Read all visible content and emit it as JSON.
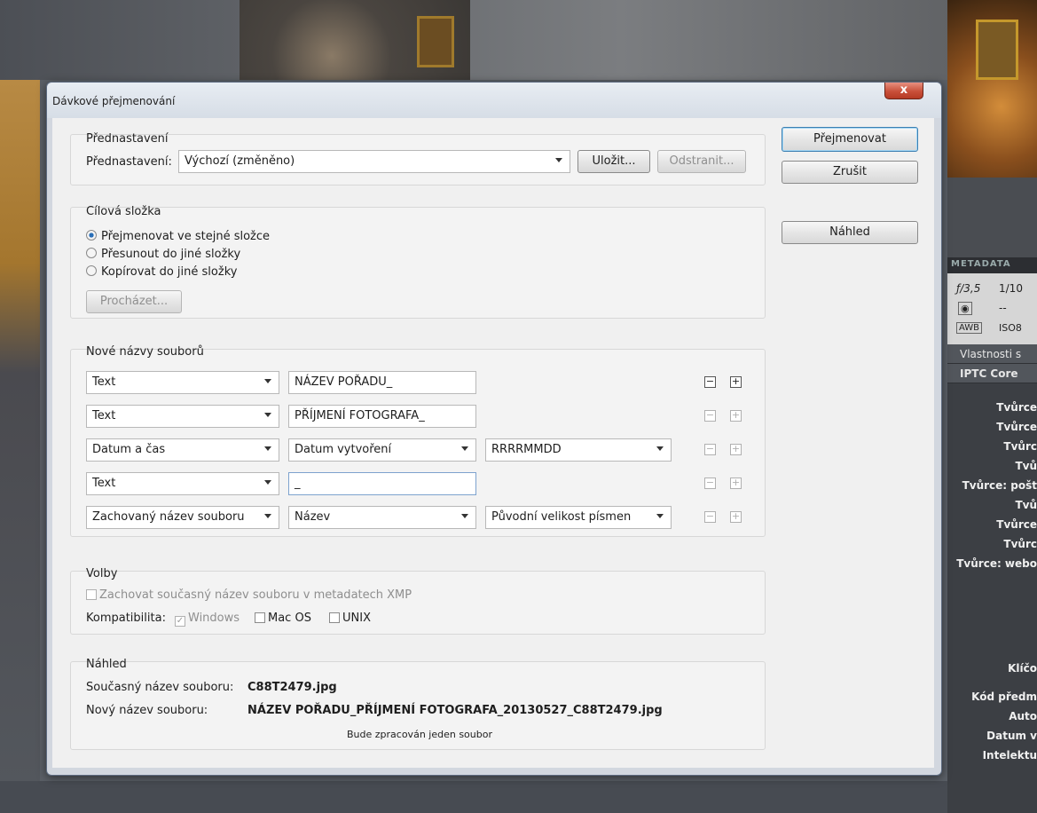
{
  "dialog": {
    "title": "Dávkové přejmenování",
    "close_label": "x",
    "buttons": {
      "rename": "Přejmenovat",
      "cancel": "Zrušit",
      "preview": "Náhled"
    }
  },
  "presets": {
    "group_label": "Přednastavení",
    "label": "Přednastavení:",
    "value": "Výchozí (změněno)",
    "save": "Uložit...",
    "delete": "Odstranit..."
  },
  "destination": {
    "group_label": "Cílová složka",
    "options": [
      "Přejmenovat ve stejné složce",
      "Přesunout do jiné složky",
      "Kopírovat do jiné složky"
    ],
    "selected": 0,
    "browse": "Procházet..."
  },
  "new_names": {
    "group_label": "Nové názvy souborů",
    "rows": [
      {
        "type": "Text",
        "field": "NÁZEV POŘADU_"
      },
      {
        "type": "Text",
        "field": "PŘÍJMENÍ FOTOGRAFA_"
      },
      {
        "type": "Datum a čas",
        "option1": "Datum vytvoření",
        "option2": "RRRRMMDD"
      },
      {
        "type": "Text",
        "field": "_"
      },
      {
        "type": "Zachovaný název souboru",
        "option1": "Název",
        "option2": "Původní velikost písmen"
      }
    ]
  },
  "options": {
    "group_label": "Volby",
    "keep_xmp": "Zachovat současný název souboru v metadatech XMP",
    "compat_label": "Kompatibilita:",
    "windows": "Windows",
    "macos": "Mac OS",
    "unix": "UNIX"
  },
  "preview": {
    "group_label": "Náhled",
    "current_label": "Současný název souboru:",
    "current_value": "C88T2479.jpg",
    "new_label": "Nový název souboru:",
    "new_value": "NÁZEV POŘADU_PŘÍJMENÍ FOTOGRAFA_20130527_C88T2479.jpg",
    "status": "Bude zpracován jeden soubor"
  },
  "metadata_panel": {
    "tab": "METADATA",
    "aperture": "ƒ/3,5",
    "shutter": "1/10",
    "dash": "--",
    "awb": "AWB",
    "iso": "ISO8",
    "section1": "Vlastnosti s",
    "section2": "IPTC Core",
    "fields": [
      "Tvůrce",
      "Tvůrce",
      "Tvůrc",
      "Tvů",
      "Tvůrce: pošt",
      "Tvů",
      "Tvůrce",
      "Tvůrc",
      "Tvůrce: webo",
      "Klíčo",
      "Kód předm",
      "Auto",
      "Datum v",
      "Intelektu"
    ]
  }
}
